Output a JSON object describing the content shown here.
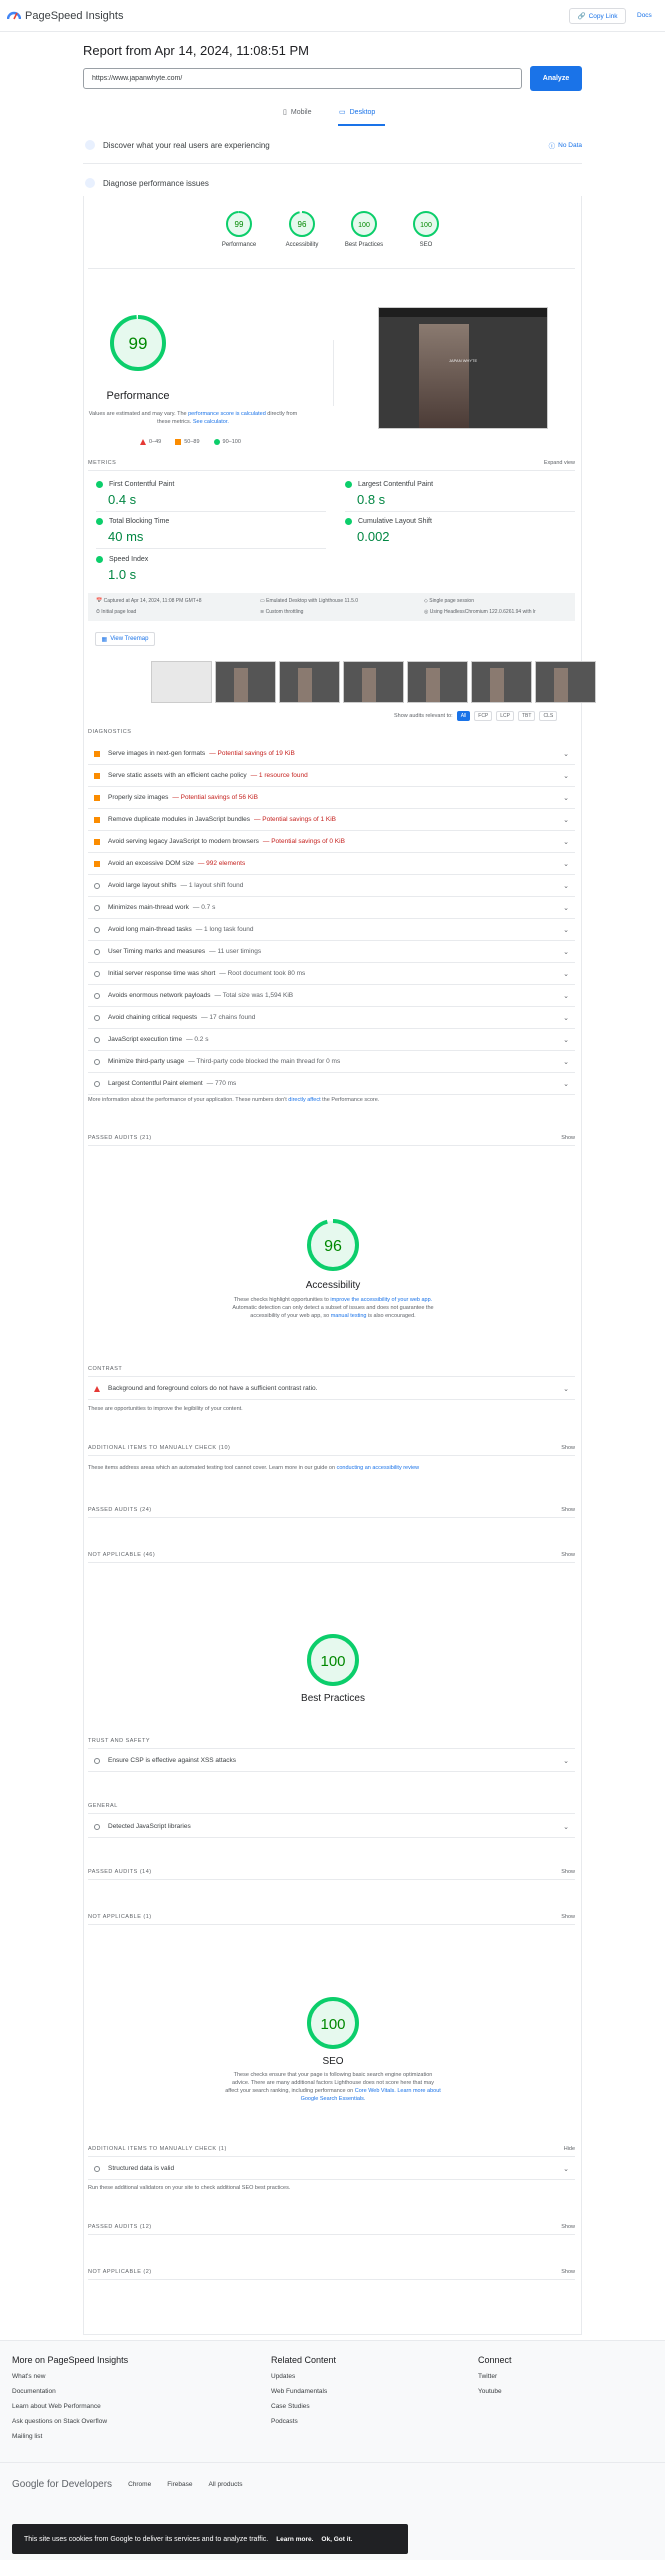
{
  "header": {
    "app_title": "PageSpeed Insights",
    "copy_link": "Copy Link",
    "docs": "Docs"
  },
  "report": {
    "title": "Report from Apr 14, 2024, 11:08:51 PM",
    "url": "https://www.japanwhyte.com/",
    "analyze": "Analyze"
  },
  "tabs": {
    "mobile": "Mobile",
    "desktop": "Desktop",
    "active": "desktop"
  },
  "sections": {
    "discover": "Discover what your real users are experiencing",
    "no_data": "No Data",
    "diagnose": "Diagnose performance issues"
  },
  "scores": [
    {
      "label": "Performance",
      "value": "99",
      "score": 99
    },
    {
      "label": "Accessibility",
      "value": "96",
      "score": 96
    },
    {
      "label": "Best Practices",
      "value": "100",
      "score": 100
    },
    {
      "label": "SEO",
      "value": "100",
      "score": 100
    }
  ],
  "performance": {
    "title": "Performance",
    "note_a": "Values are estimated and may vary. The",
    "note_link": "performance score is calculated",
    "note_b": "directly from these metrics.",
    "note_link2": "See calculator.",
    "legend": [
      "0–49",
      "50–89",
      "90–100"
    ],
    "screenshot_text": "JAPAN WHYTE"
  },
  "metrics": {
    "header": "METRICS",
    "expand": "Expand view",
    "items": [
      {
        "name": "First Contentful Paint",
        "value": "0.4 s"
      },
      {
        "name": "Largest Contentful Paint",
        "value": "0.8 s"
      },
      {
        "name": "Total Blocking Time",
        "value": "40 ms"
      },
      {
        "name": "Cumulative Layout Shift",
        "value": "0.002"
      },
      {
        "name": "Speed Index",
        "value": "1.0 s"
      }
    ]
  },
  "environment": {
    "captured": "Captured at Apr 14, 2024, 11:08 PM GMT+8",
    "initial": "Initial page load",
    "emulated": "Emulated Desktop with Lighthouse 11.5.0",
    "throttling": "Custom throttling",
    "session": "Single page session",
    "browser": "Using HeadlessChromium 122.0.6261.94 with lr"
  },
  "treemap": "View Treemap",
  "audit_filter": {
    "label": "Show audits relevant to:",
    "chips": [
      "All",
      "FCP",
      "LCP",
      "TBT",
      "CLS"
    ]
  },
  "diagnostics": {
    "header": "DIAGNOSTICS",
    "items": [
      {
        "text": "Serve images in next-gen formats",
        "detail": "— Potential savings of 19 KiB",
        "type": "warn"
      },
      {
        "text": "Serve static assets with an efficient cache policy",
        "detail": "— 1 resource found",
        "type": "warn"
      },
      {
        "text": "Properly size images",
        "detail": "— Potential savings of 56 KiB",
        "type": "warn"
      },
      {
        "text": "Remove duplicate modules in JavaScript bundles",
        "detail": "— Potential savings of 1 KiB",
        "type": "warn"
      },
      {
        "text": "Avoid serving legacy JavaScript to modern browsers",
        "detail": "— Potential savings of 0 KiB",
        "type": "warn"
      },
      {
        "text": "Avoid an excessive DOM size",
        "detail": "— 992 elements",
        "type": "warn"
      },
      {
        "text": "Avoid large layout shifts",
        "detail": "— 1 layout shift found",
        "type": "info"
      },
      {
        "text": "Minimizes main-thread work",
        "detail": "— 0.7 s",
        "type": "info"
      },
      {
        "text": "Avoid long main-thread tasks",
        "detail": "— 1 long task found",
        "type": "info"
      },
      {
        "text": "User Timing marks and measures",
        "detail": "— 11 user timings",
        "type": "info"
      },
      {
        "text": "Initial server response time was short",
        "detail": "— Root document took 80 ms",
        "type": "info"
      },
      {
        "text": "Avoids enormous network payloads",
        "detail": "— Total size was 1,594 KiB",
        "type": "info"
      },
      {
        "text": "Avoid chaining critical requests",
        "detail": "— 17 chains found",
        "type": "info"
      },
      {
        "text": "JavaScript execution time",
        "detail": "— 0.2 s",
        "type": "info"
      },
      {
        "text": "Minimize third-party usage",
        "detail": "— Third-party code blocked the main thread for 0 ms",
        "type": "info"
      },
      {
        "text": "Largest Contentful Paint element",
        "detail": "— 770 ms",
        "type": "info"
      }
    ],
    "note_a": "More information about the performance of your application. These numbers don't",
    "note_link": "directly affect",
    "note_b": "the Performance score."
  },
  "perf_passed": {
    "label": "PASSED AUDITS (21)",
    "show": "Show"
  },
  "accessibility": {
    "title": "Accessibility",
    "desc_a": "These checks highlight opportunities to",
    "desc_link": "improve the accessibility of your web app.",
    "desc_b": "Automatic detection can only detect a subset of issues and does not guarantee the accessibility of your web app, so",
    "desc_link2": "manual testing",
    "desc_c": "is also encouraged.",
    "contrast_hdr": "CONTRAST",
    "contrast_item": "Background and foreground colors do not have a sufficient contrast ratio.",
    "contrast_note": "These are opportunities to improve the legibility of your content.",
    "manual_hdr": "ADDITIONAL ITEMS TO MANUALLY CHECK (10)",
    "manual_note_a": "These items address areas which an automated testing tool cannot cover. Learn more in our guide on",
    "manual_note_link": "conducting an accessibility review",
    "passed": "PASSED AUDITS (24)",
    "na": "NOT APPLICABLE (46)",
    "show": "Show"
  },
  "best_practices": {
    "title": "Best Practices",
    "trust_hdr": "TRUST AND SAFETY",
    "trust_item": "Ensure CSP is effective against XSS attacks",
    "general_hdr": "GENERAL",
    "general_item": "Detected JavaScript libraries",
    "passed": "PASSED AUDITS (14)",
    "na": "NOT APPLICABLE (1)",
    "show": "Show"
  },
  "seo": {
    "title": "SEO",
    "desc_a": "These checks ensure that your page is following basic search engine optimization advice. There are many additional factors Lighthouse does not score here that may affect your search ranking, including performance on",
    "desc_link": "Core Web Vitals.",
    "desc_link2": "Learn more about Google Search Essentials.",
    "manual_hdr": "ADDITIONAL ITEMS TO MANUALLY CHECK (1)",
    "hide": "Hide",
    "manual_item": "Structured data is valid",
    "manual_note": "Run these additional validators on your site to check additional SEO best practices.",
    "passed": "PASSED AUDITS (12)",
    "na": "NOT APPLICABLE (2)",
    "show": "Show"
  },
  "footer": {
    "col1": {
      "title": "More on PageSpeed Insights",
      "links": [
        "What's new",
        "Documentation",
        "Learn about Web Performance",
        "Ask questions on Stack Overflow",
        "Mailing list"
      ]
    },
    "col2": {
      "title": "Related Content",
      "links": [
        "Updates",
        "Web Fundamentals",
        "Case Studies",
        "Podcasts"
      ]
    },
    "col3": {
      "title": "Connect",
      "links": [
        "Twitter",
        "Youtube"
      ]
    },
    "brand": "Google for Developers",
    "bottom_links": [
      "Chrome",
      "Firebase",
      "All products"
    ]
  },
  "cookie": {
    "text": "This site uses cookies from Google to deliver its services and to analyze traffic.",
    "learn": "Learn more.",
    "ok": "Ok, Got it."
  },
  "colors": {
    "accent": "#1a73e8",
    "pass": "#0cce6b",
    "average": "#fb8c00",
    "fail": "#e53935"
  }
}
